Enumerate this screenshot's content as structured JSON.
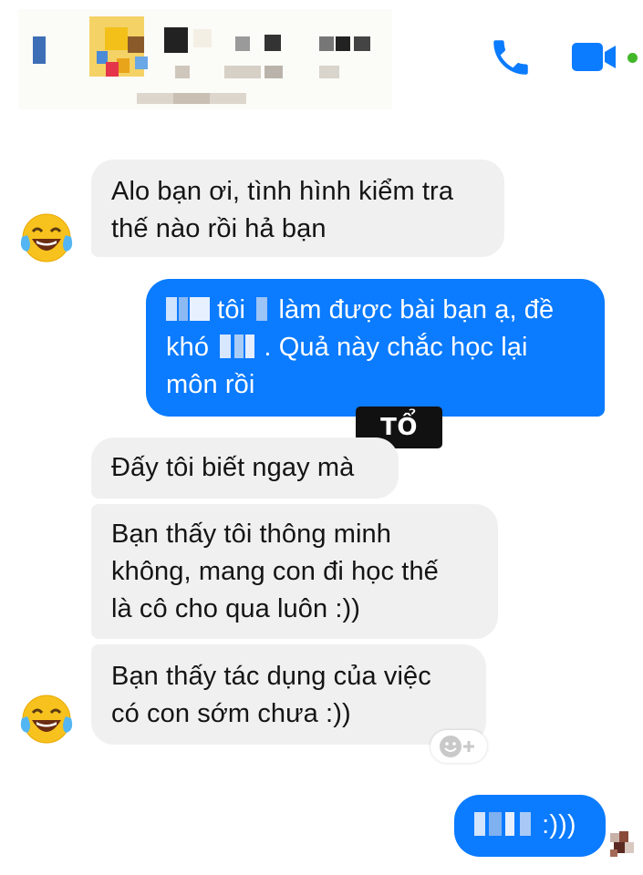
{
  "header": {
    "call_icon": "phone-icon",
    "video_icon": "video-camera-icon",
    "active_color": "#42b72a",
    "accent": "#0b7bff"
  },
  "messages": [
    {
      "from": "them",
      "lines": [
        "Alo bạn ơi, tình hình kiểm tra",
        "thế nào rồi hả bạn"
      ]
    },
    {
      "from": "me",
      "line1_a": "tôi",
      "line1_b": "làm được bài bạn ạ, đề",
      "line2_a": "khó",
      "line2_b": ". Quả này chắc học lại",
      "line3": "môn rồi"
    },
    {
      "from": "them",
      "lines": [
        "Đấy tôi biết ngay mà"
      ]
    },
    {
      "from": "them",
      "lines": [
        "Bạn thấy tôi thông minh",
        "không, mang con đi học thế",
        "là cô cho qua luôn :))"
      ]
    },
    {
      "from": "them",
      "lines": [
        "Bạn thấy tác dụng của việc",
        "có con sớm chưa :))"
      ]
    },
    {
      "from": "me",
      "tail": ":)))"
    }
  ],
  "sticker": {
    "text": "TỔ LÁI"
  },
  "avatar_icon": "laughing-crying-emoji-icon",
  "reaction_icon": "add-reaction-icon"
}
